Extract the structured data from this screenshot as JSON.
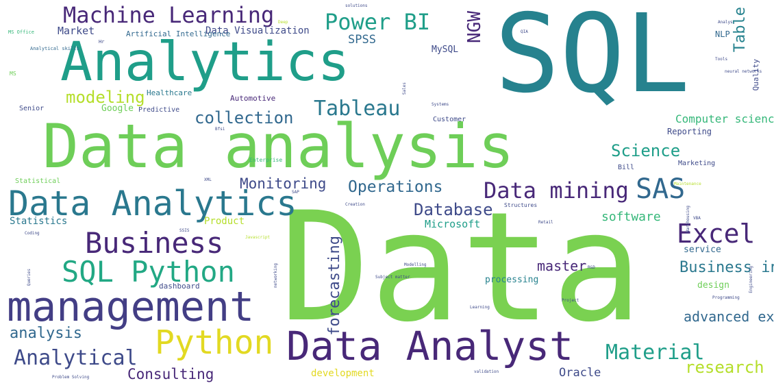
{
  "palette": {
    "dark_purple": "#482878",
    "indigo": "#3e4a89",
    "blue": "#31688e",
    "teal": "#26828e",
    "sea_green": "#1f9e89",
    "green": "#35b779",
    "light_green": "#6ece58",
    "lime": "#b5de2b",
    "yellow": "#e2d922"
  },
  "words": [
    "SQL",
    "Data",
    "Data analysis",
    "Analytics",
    "management",
    "Data Analyst",
    "Data Analytics",
    "Machine Learning",
    "Power BI",
    "Business",
    "SQL Python",
    "Python",
    "Tableau",
    "SAS",
    "Excel",
    "Data mining",
    "Analytical",
    "collection",
    "modeling",
    "Science",
    "Monitoring",
    "Operations",
    "Database",
    "Material",
    "analysis",
    "Consulting",
    "advanced excel",
    "research",
    "Oracle",
    "development",
    "Business intelligence",
    "master",
    "SPSS",
    "Market",
    "Data Visualization",
    "Artificial Intelligence",
    "Statistics",
    "Microsoft",
    "Product",
    "software",
    "Computer science",
    "Reporting",
    "Marketing",
    "service",
    "design",
    "Statistical",
    "Senior",
    "Predictive",
    "Google",
    "Healthcare",
    "Automotive",
    "Customer",
    "Bill",
    "processing",
    "Structures",
    "dashboard",
    "MySQL",
    "NLP",
    "MS Office",
    "Analytical skills",
    "Hr",
    "MS",
    "Deep",
    "solutions",
    "QIA",
    "Analyst",
    "Tools",
    "neural networks",
    "Systems",
    "Bfsi",
    "Enterprise",
    "XML",
    "SAP",
    "Creation",
    "Maintenance",
    "VBA",
    "Retail",
    "SSIS",
    "Javascript",
    "Coding",
    "Modelling",
    "R&D",
    "Subject matter",
    "Programming",
    "Learning",
    "Project",
    "validation",
    "Problem Solving",
    "NGW",
    "Table",
    "Quality",
    "forecasting",
    "Sales",
    "Warehousing",
    "Engineering",
    "Queries",
    "networking"
  ]
}
